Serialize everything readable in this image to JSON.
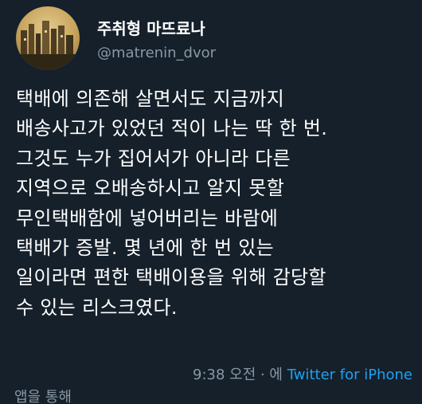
{
  "tweet": {
    "author": {
      "display_name": "주취형 마뜨료나",
      "handle": "@matrenin_dvor"
    },
    "text_lines": [
      "택배에 의존해 살면서도 지금까지",
      "배송사고가 있었던 적이 나는 딱 한 번.",
      "그것도 누가 집어서가 아니라 다른",
      "지역으로 오배송하시고 알지 못할",
      "무인택배함에 넣어버리는 바람에",
      "택배가 증발. 몇 년에 한 번 있는",
      "일이라면 편한 택배이용을 위해 감당할",
      "수 있는 리스크였다."
    ],
    "time": "9:38 오전",
    "separator": " · 에 ",
    "app_name": "Twitter for iPhone",
    "via_text": "앱을 통해"
  },
  "colors": {
    "background": "#15202b",
    "text": "#ffffff",
    "muted": "#8899a6",
    "link": "#1da1f2"
  }
}
